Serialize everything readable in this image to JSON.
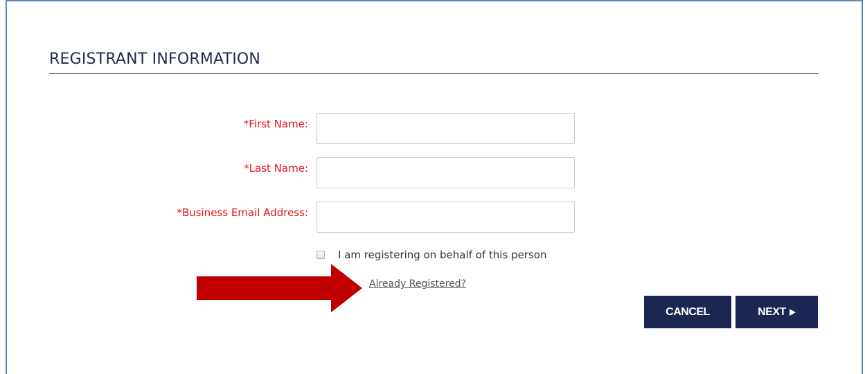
{
  "section": {
    "title": "REGISTRANT INFORMATION"
  },
  "form": {
    "fields": [
      {
        "label": "*First Name:",
        "value": ""
      },
      {
        "label": "*Last Name:",
        "value": ""
      },
      {
        "label": "*Business Email Address:",
        "value": ""
      }
    ],
    "on_behalf_checkbox": {
      "label": "I am registering on behalf of this person",
      "checked": false
    },
    "already_registered_link": "Already Registered?"
  },
  "actions": {
    "cancel_label": "CANCEL",
    "next_label": "NEXT"
  },
  "colors": {
    "required_label": "#e3141b",
    "button_bg": "#1b2752",
    "title_text": "#1f2a4d",
    "arrow": "#c00000"
  },
  "icons": {
    "next": "play-triangle-icon",
    "annotation": "red-arrow-icon"
  }
}
